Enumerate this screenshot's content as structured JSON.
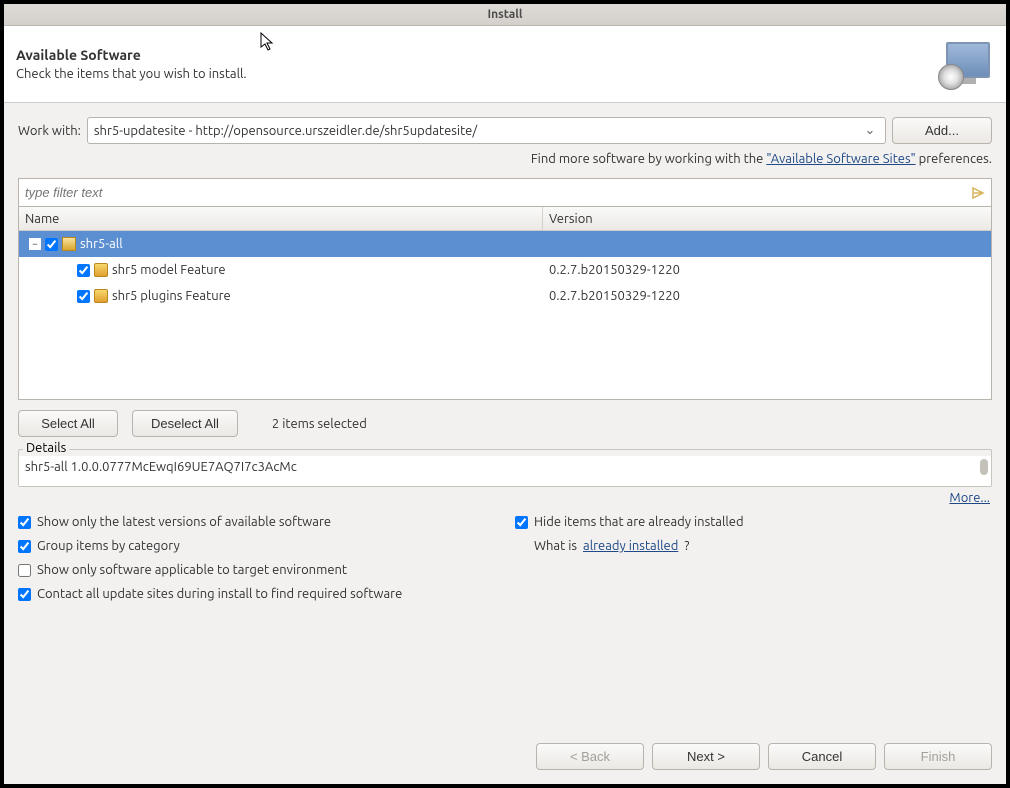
{
  "title": "Install",
  "header": {
    "heading": "Available Software",
    "subheading": "Check the items that you wish to install."
  },
  "workwith": {
    "label": "Work with:",
    "value": "shr5-updatesite - http://opensource.urszeidler.de/shr5updatesite/",
    "add_btn": "Add..."
  },
  "findmore": {
    "prefix": "Find more software by working with the ",
    "link": "\"Available Software Sites\"",
    "suffix": " preferences."
  },
  "filter_placeholder": "type filter text",
  "columns": {
    "name": "Name",
    "version": "Version"
  },
  "tree": [
    {
      "indent": 0,
      "expanded": true,
      "checked": true,
      "icon": "category",
      "name": "shr5-all",
      "version": "",
      "selected": true
    },
    {
      "indent": 1,
      "expanded": null,
      "checked": true,
      "icon": "feature",
      "name": "shr5 model Feature",
      "version": "0.2.7.b20150329-1220",
      "selected": false
    },
    {
      "indent": 1,
      "expanded": null,
      "checked": true,
      "icon": "feature",
      "name": "shr5 plugins Feature",
      "version": "0.2.7.b20150329-1220",
      "selected": false
    }
  ],
  "select_all": "Select All",
  "deselect_all": "Deselect All",
  "items_selected": "2 items selected",
  "details_label": "Details",
  "details_text": "shr5-all 1.0.0.0777McEwqI69UE7AQ7I7c3AcMc",
  "more": "More...",
  "options": {
    "latest": "Show only the latest versions of available software",
    "hide": "Hide items that are already installed",
    "group": "Group items by category",
    "whatis_prefix": "What is ",
    "whatis_link": "already installed",
    "whatis_suffix": "?",
    "target": "Show only software applicable to target environment",
    "contact": "Contact all update sites during install to find required software"
  },
  "options_state": {
    "latest": true,
    "hide": true,
    "group": true,
    "target": false,
    "contact": true
  },
  "buttons": {
    "back": "< Back",
    "next": "Next >",
    "cancel": "Cancel",
    "finish": "Finish"
  }
}
